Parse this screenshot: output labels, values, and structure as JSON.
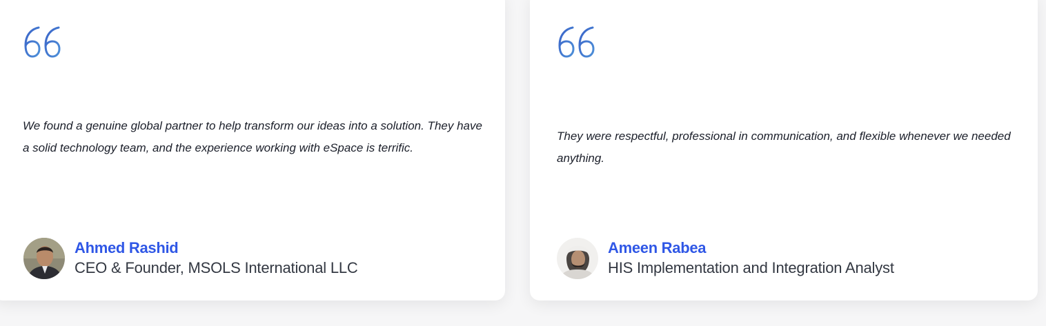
{
  "accent_color": "#2f57e6",
  "testimonials": [
    {
      "icon": "quote-icon",
      "quote": "We found a genuine global partner to help transform our ideas into a solution. They have a solid technology team, and the experience working with eSpace is terrific.",
      "author_name": "Ahmed Rashid",
      "author_role": "CEO & Founder, MSOLS International LLC"
    },
    {
      "icon": "quote-icon",
      "quote": "They were respectful, professional in communication, and flexible whenever we needed anything.",
      "author_name": "Ameen Rabea",
      "author_role": "HIS Implementation and Integration Analyst"
    }
  ]
}
